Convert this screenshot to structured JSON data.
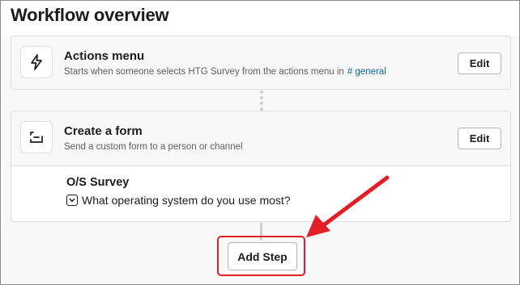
{
  "page": {
    "title": "Workflow overview"
  },
  "steps": [
    {
      "title": "Actions menu",
      "description": "Starts when someone selects HTG Survey from the actions menu in",
      "channel": "# general",
      "icon": "lightning-icon",
      "edit_label": "Edit"
    },
    {
      "title": "Create a form",
      "description": "Send a custom form to a person or channel",
      "icon": "form-icon",
      "edit_label": "Edit",
      "form": {
        "name": "O/S Survey",
        "question": "What operating system do you use most?",
        "question_icon": "dropdown-icon"
      }
    }
  ],
  "actions": {
    "add_step_label": "Add Step"
  },
  "annotation": {
    "color": "#e41e26"
  }
}
